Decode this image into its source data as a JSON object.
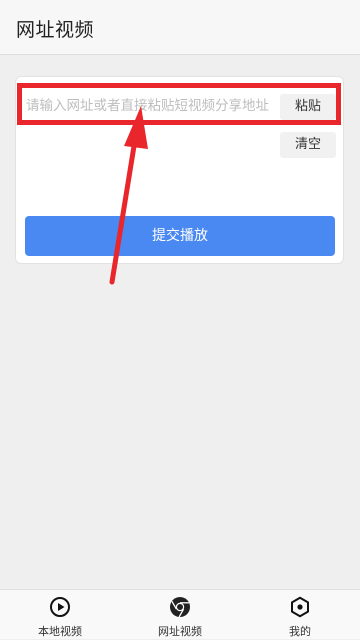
{
  "header": {
    "title": "网址视频"
  },
  "form": {
    "url_placeholder": "请输入网址或者直接粘贴短视频分享地址",
    "url_value": "",
    "paste_label": "粘贴",
    "clear_label": "清空",
    "submit_label": "提交播放"
  },
  "bottom_nav": {
    "items": [
      {
        "label": "本地视频",
        "icon": "play-circle-icon"
      },
      {
        "label": "网址视频",
        "icon": "chrome-browser-icon",
        "active": true
      },
      {
        "label": "我的",
        "icon": "hexagon-user-icon"
      }
    ]
  },
  "colors": {
    "accent": "#4a88f2",
    "annotation": "#e8262b",
    "background": "#efefef"
  }
}
